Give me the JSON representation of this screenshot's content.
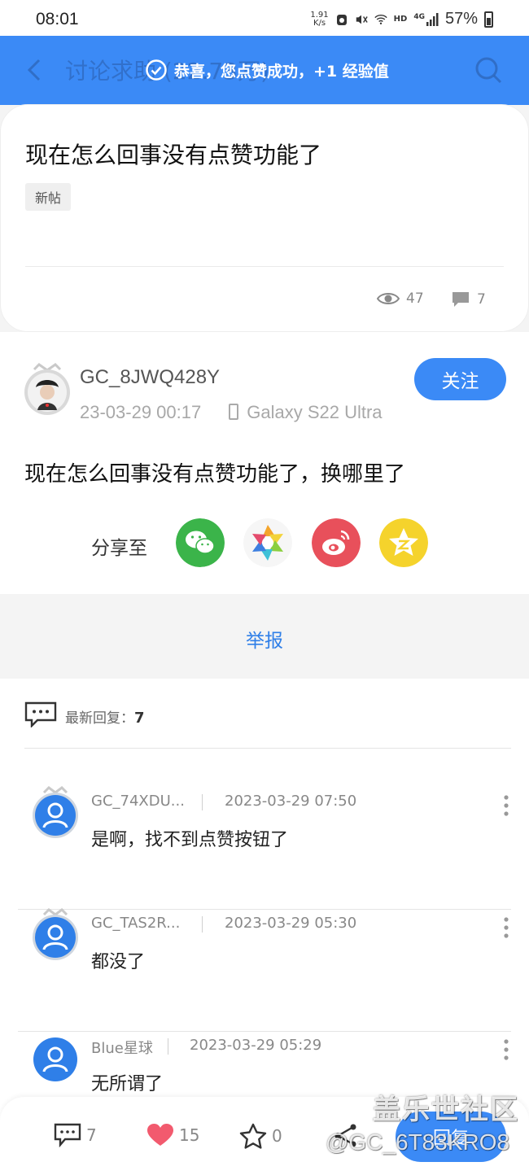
{
  "status_bar": {
    "time": "08:01",
    "speed_value": "1.91",
    "speed_unit": "K/s",
    "hd_label": "HD",
    "network_label": "4G",
    "battery_percent": "57%"
  },
  "header": {
    "title": "讨论求助 (22.73万)",
    "toast": "恭喜，您点赞成功，+1 经验值"
  },
  "post": {
    "title": "现在怎么回事没有点赞功能了",
    "tag": "新帖",
    "views": "47",
    "comments": "7",
    "author": "GC_8JWQ428Y",
    "date": "23-03-29 00:17",
    "device": "Galaxy S22 Ultra",
    "follow_label": "关注",
    "content": "现在怎么回事没有点赞功能了，换哪里了",
    "share_label": "分享至",
    "share_targets": [
      "wechat-icon",
      "moments-icon",
      "weibo-icon",
      "qzone-icon"
    ]
  },
  "report": {
    "label": "举报"
  },
  "replies": {
    "header_label": "最新回复：",
    "count": "7",
    "items": [
      {
        "user": "GC_74XDU...",
        "time": "2023-03-29 07:50",
        "text": "是啊，找不到点赞按钮了"
      },
      {
        "user": "GC_TAS2R...",
        "time": "2023-03-29 05:30",
        "text": "都没了"
      },
      {
        "user": "Blue星球",
        "time": "2023-03-29 05:29",
        "text": "无所谓了"
      }
    ]
  },
  "bottom_bar": {
    "comments": "7",
    "likes": "15",
    "favorites": "0",
    "reply_label": "回复"
  },
  "watermark": {
    "line1": "盖乐世社区",
    "line2": "@GC_6T83KRO8"
  },
  "colors": {
    "accent": "#3b8af6",
    "link": "#2f7fe8",
    "like": "#f25a6e"
  }
}
